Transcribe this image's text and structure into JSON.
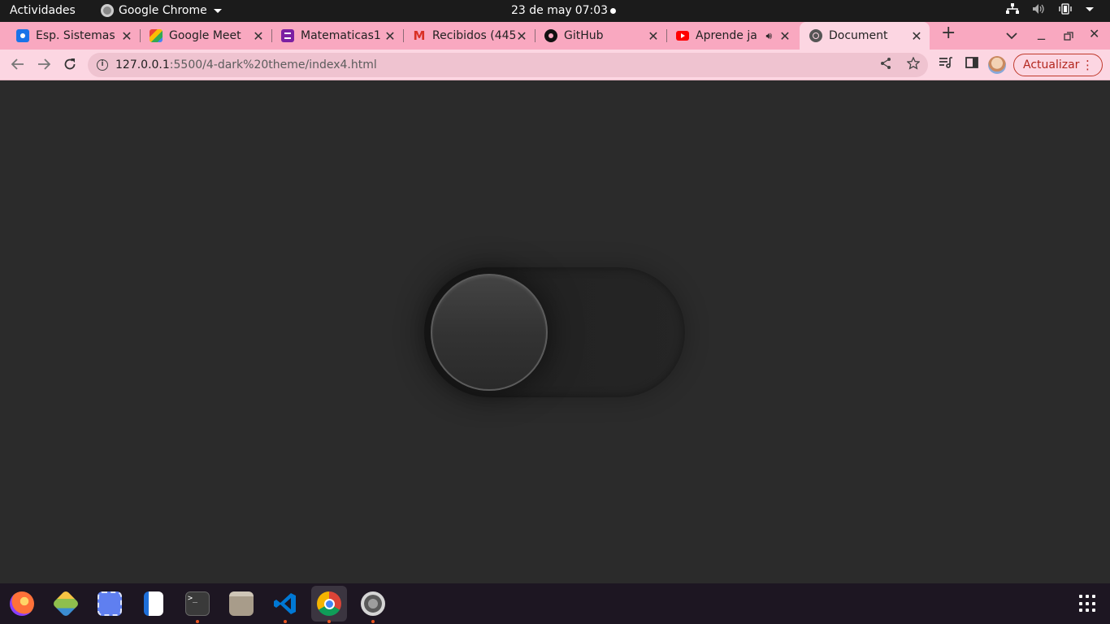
{
  "topbar": {
    "activities": "Actividades",
    "app_name": "Google Chrome",
    "date": "23 de may",
    "time": "07:03"
  },
  "tabs": [
    {
      "title": "Esp. Sistemas",
      "favicon": "classroom-icon",
      "favicon_color": "#1a73e8"
    },
    {
      "title": "Google Meet",
      "favicon": "meet-icon",
      "favicon_color": "#00897b"
    },
    {
      "title": "Matematicas1",
      "favicon": "forms-icon",
      "favicon_color": "#7b1fa2"
    },
    {
      "title": "Recibidos (445",
      "favicon": "gmail-icon",
      "favicon_color": "#d93025"
    },
    {
      "title": "GitHub",
      "favicon": "github-icon",
      "favicon_color": "#111111"
    },
    {
      "title": "Aprende ja",
      "favicon": "youtube-icon",
      "favicon_color": "#ff0000"
    },
    {
      "title": "Document",
      "favicon": "globe-icon",
      "favicon_color": "#555555",
      "active": true
    }
  ],
  "toolbar": {
    "url_host": "127.0.0.1",
    "url_path": ":5500/4-dark%20theme/index4.html",
    "update_label": "Actualizar"
  },
  "page": {
    "toggle_state": "off",
    "background": "#2b2b2b"
  },
  "dock": {
    "items": [
      {
        "name": "firefox",
        "color": "#ff7139",
        "running": false
      },
      {
        "name": "netbeans",
        "color": "#8fbf4d",
        "running": false
      },
      {
        "name": "screenshot",
        "color": "#5f7ff0",
        "running": false
      },
      {
        "name": "writer",
        "color": "#1e6fd9",
        "running": false
      },
      {
        "name": "terminal",
        "color": "#3a3a3a",
        "running": true
      },
      {
        "name": "files",
        "color": "#a89c8a",
        "running": false
      },
      {
        "name": "vscode",
        "color": "#0078d4",
        "running": true
      },
      {
        "name": "chrome",
        "color": "#e8eaed",
        "running": true
      },
      {
        "name": "settings",
        "color": "#9e9e9e",
        "running": true
      }
    ]
  }
}
